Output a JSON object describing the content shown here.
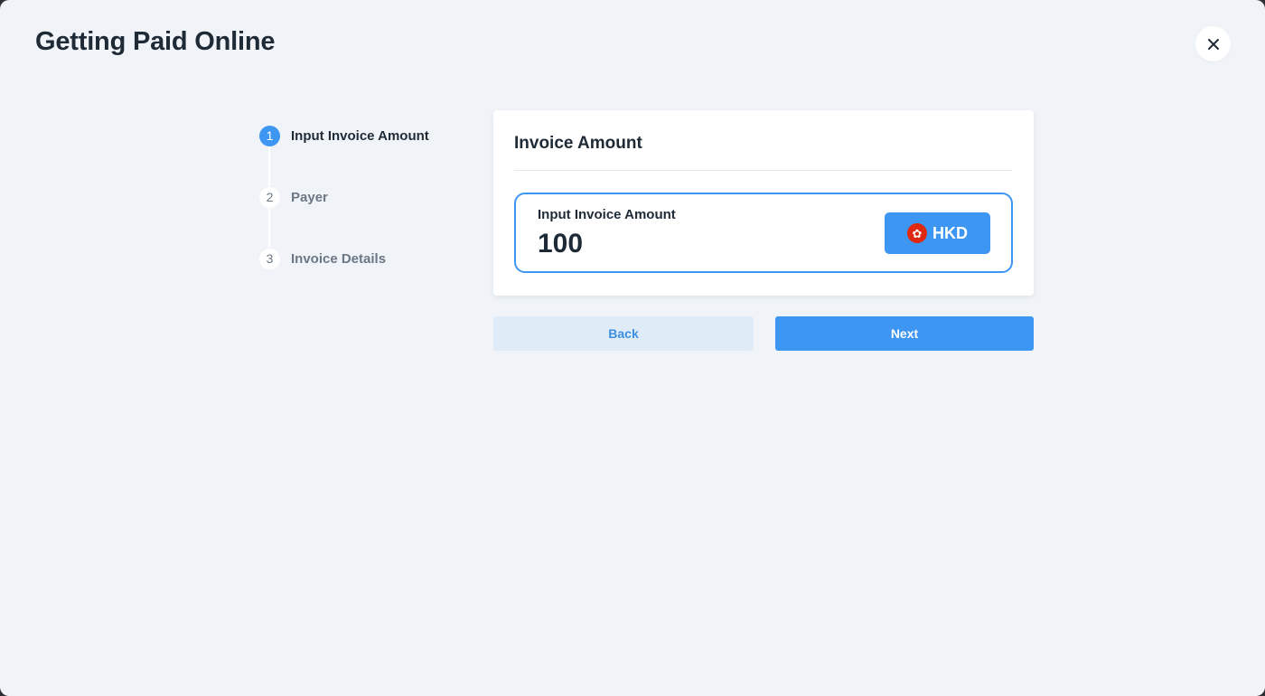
{
  "header": {
    "title": "Getting Paid Online",
    "close_icon": "close-icon"
  },
  "stepper": {
    "steps": [
      {
        "number": "1",
        "label": "Input Invoice Amount",
        "state": "active"
      },
      {
        "number": "2",
        "label": "Payer",
        "state": "inactive"
      },
      {
        "number": "3",
        "label": "Invoice Details",
        "state": "inactive"
      }
    ]
  },
  "card": {
    "title": "Invoice Amount",
    "amount_field": {
      "label": "Input Invoice Amount",
      "value": "100"
    },
    "currency": {
      "code": "HKD",
      "flag_icon": "hong-kong-flag-icon",
      "flag_glyph": "✿"
    }
  },
  "actions": {
    "back_label": "Back",
    "next_label": "Next"
  },
  "colors": {
    "accent": "#3d96f2",
    "background": "#f0f4f8",
    "text": "#1f2a37",
    "muted": "#6b7785",
    "secondary_button": "#e0ebf8",
    "flag_red": "#de2910"
  }
}
